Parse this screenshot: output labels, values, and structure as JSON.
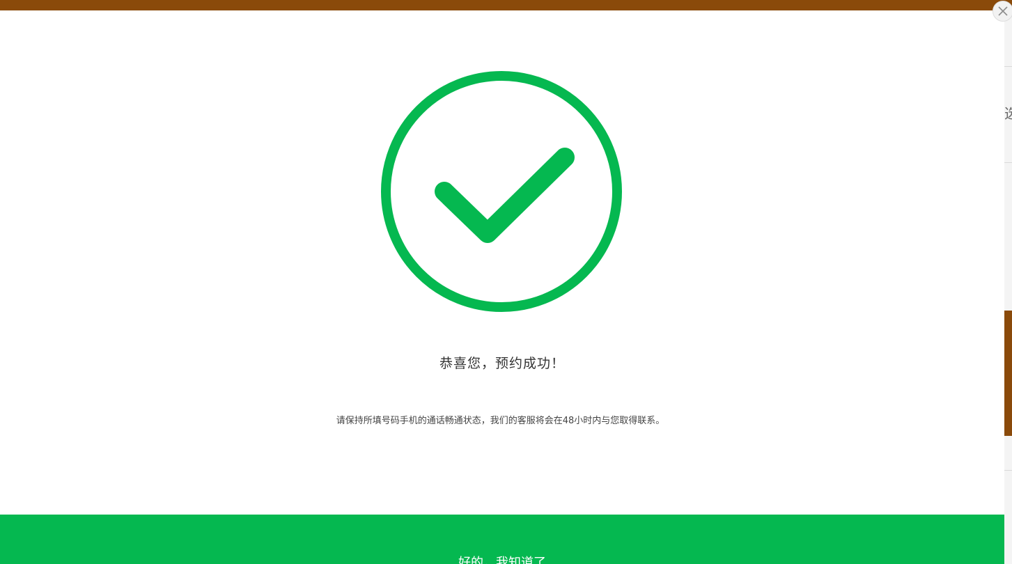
{
  "modal": {
    "title": "恭喜您，预约成功！",
    "message": "请保持所填号码手机的通话畅通状态，我们的客服将会在48小时内与您取得联系。",
    "confirm_label": "好的，我知道了",
    "close_icon": "close-icon",
    "success_icon": "check-circle-icon"
  },
  "background": {
    "partial_glyph": "选"
  },
  "colors": {
    "accent_green": "#05b850",
    "top_bar_brown": "#8a4a0a"
  }
}
